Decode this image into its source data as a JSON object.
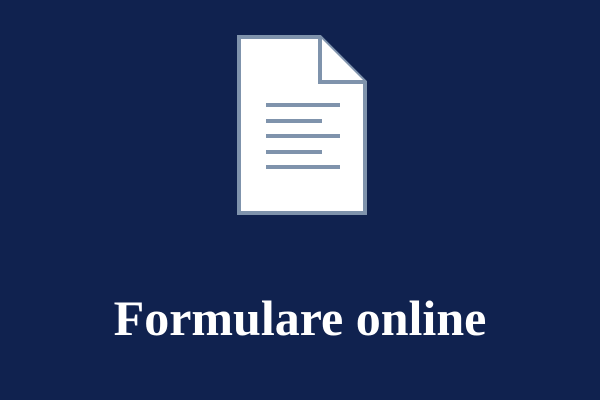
{
  "tile": {
    "label": "Formulare online",
    "icon": "document-icon"
  },
  "colors": {
    "background": "#10224f",
    "document_fill": "#ffffff",
    "document_stroke": "#7f93ac",
    "text": "#ffffff"
  }
}
